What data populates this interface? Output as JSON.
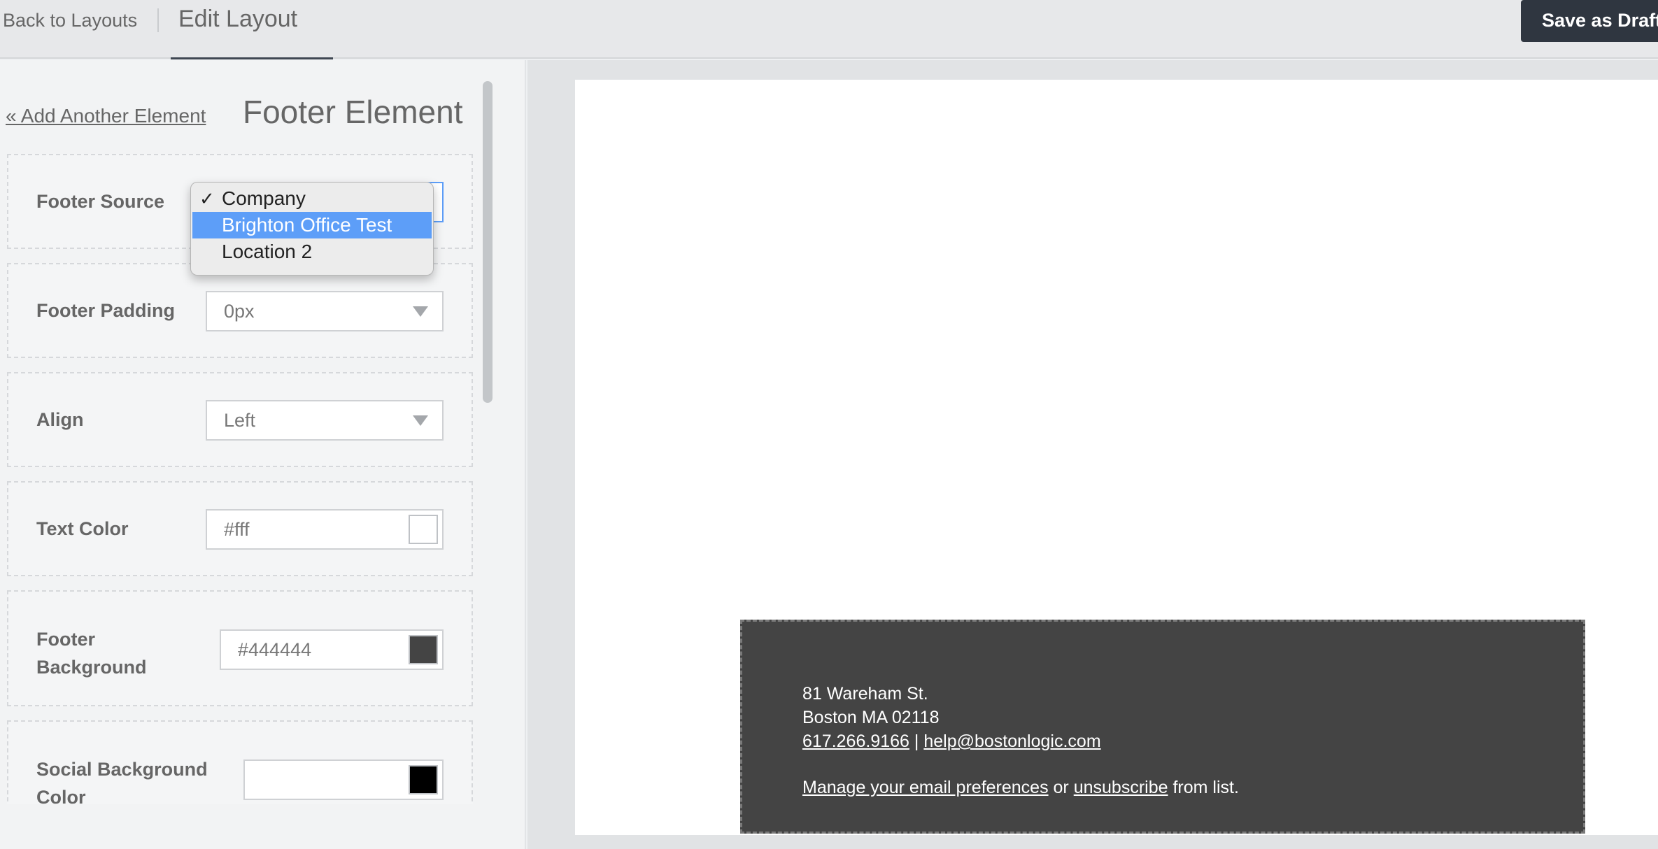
{
  "header": {
    "back_link": "Back to Layouts",
    "title": "Edit Layout",
    "save_button": "Save as Draft"
  },
  "sidebar": {
    "add_element_link": "« Add Another Element",
    "panel_title": "Footer Element",
    "fields": {
      "footer_source": {
        "label": "Footer Source",
        "value": "Company"
      },
      "footer_padding": {
        "label": "Footer Padding",
        "value": "0px"
      },
      "align": {
        "label": "Align",
        "value": "Left"
      },
      "text_color": {
        "label": "Text Color",
        "value": "#fff",
        "swatch": "#ffffff"
      },
      "footer_background": {
        "label_line1": "Footer",
        "label_line2": "Background",
        "value": "#444444",
        "swatch": "#444444"
      },
      "social_background": {
        "label_line1": "Social Background",
        "label_line2": "Color",
        "value": "",
        "swatch": "#000000"
      }
    }
  },
  "dropdown": {
    "options": [
      "Company",
      "Brighton Office Test",
      "Location 2"
    ],
    "checked_option": "Company",
    "highlighted_option": "Brighton Office Test",
    "highlight_color": "#5d9ef8"
  },
  "email_footer": {
    "background": "#444444",
    "address_line1": "81 Wareham St.",
    "address_line2": "Boston MA 02118",
    "phone": "617.266.9166",
    "separator": "|",
    "email": "help@bostonlogic.com",
    "manage_link": "Manage your email preferences",
    "or_text": "or",
    "unsubscribe_link": "unsubscribe",
    "from_list_text": "from list."
  },
  "colors": {
    "save_button_bg": "#2f3640",
    "accent_blue": "#5d9ef8"
  }
}
